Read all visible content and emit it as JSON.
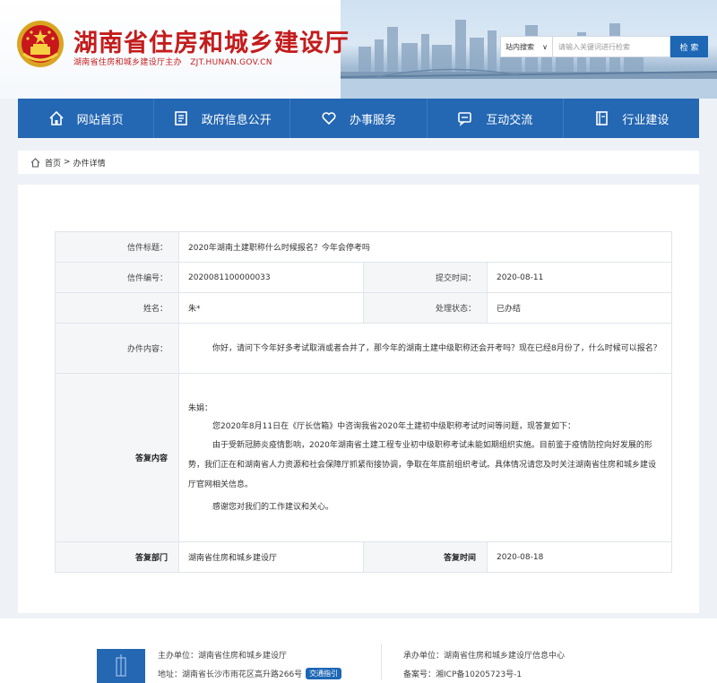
{
  "header": {
    "title": "湖南省住房和城乡建设厅",
    "subtitle": "湖南省住房和城乡建设厅主办　ZJT.HUNAN.GOV.CN",
    "search_scope": "站内搜索",
    "search_placeholder": "请输入关键词进行检索",
    "search_button": "检 索"
  },
  "nav": {
    "items": [
      {
        "label": "网站首页",
        "icon": "home-icon"
      },
      {
        "label": "政府信息公开",
        "icon": "document-icon"
      },
      {
        "label": "办事服务",
        "icon": "heart-icon"
      },
      {
        "label": "互动交流",
        "icon": "chat-icon"
      },
      {
        "label": "行业建设",
        "icon": "book-icon"
      }
    ]
  },
  "breadcrumb": {
    "home": "首页",
    "separator": ">",
    "current": "办件详情"
  },
  "letter": {
    "title_label": "信件标题：",
    "title_value": "2020年湖南土建职称什么时候报名？今年会停考吗",
    "number_label": "信件编号：",
    "number_value": "2020081100000033",
    "submit_label": "提交时间：",
    "submit_value": "2020-08-11",
    "name_label": "姓名：",
    "name_value": "朱*",
    "status_label": "处理状态：",
    "status_value": "已办结",
    "content_label": "办件内容：",
    "content_value": "你好，请问下今年好多考试取消或者合并了，那今年的湖南土建中级职称还会开考吗？现在已经8月份了，什么时候可以报名？",
    "reply_label": "答复内容",
    "reply_greeting": "朱娟：",
    "reply_p1": "您2020年8月11日在《厅长信箱》中咨询我省2020年土建初中级职称考试时间等问题，现答复如下：",
    "reply_p2": "由于受新冠肺炎疫情影响，2020年湖南省土建工程专业初中级职称考试未能如期组织实施。目前鉴于疫情防控向好发展的形势，我们正在和湖南省人力资源和社会保障厅抓紧衔接协调，争取在年底前组织考试。具体情况请您及时关注湖南省住房和城乡建设厅官网相关信息。",
    "reply_p3": "感谢您对我们的工作建议和关心。",
    "dept_label": "答复部门",
    "dept_value": "湖南省住房和城乡建设厅",
    "reply_time_label": "答复时间",
    "reply_time_value": "2020-08-18"
  },
  "footer": {
    "host": "主办单位：湖南省住房和城乡建设厅",
    "address": "地址：湖南省长沙市雨花区高升路266号",
    "guide": "交通指引",
    "undertaker": "承办单位：湖南省住房和城乡建设厅信息中心",
    "icp": "备案号：湘ICP备10205723号-1"
  },
  "colors": {
    "brand_red": "#c41c1c",
    "nav_blue": "#2467b3",
    "button_blue": "#1d67b5"
  }
}
